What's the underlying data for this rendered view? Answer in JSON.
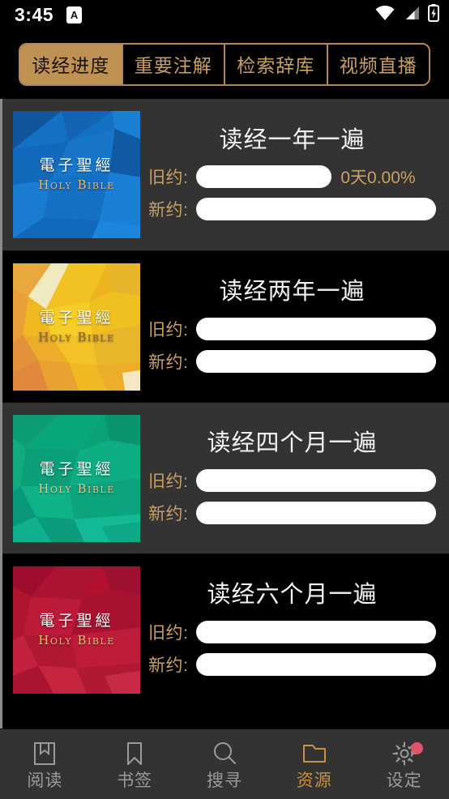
{
  "statusbar": {
    "time": "3:45",
    "app_icon_letter": "A",
    "icons": [
      "wifi-icon",
      "cellular-signal-icon",
      "battery-charging-icon"
    ]
  },
  "tabs": [
    {
      "label": "读经进度",
      "active": true,
      "name": "tab-reading-progress"
    },
    {
      "label": "重要注解",
      "active": false,
      "name": "tab-important-notes"
    },
    {
      "label": "检索辞库",
      "active": false,
      "name": "tab-search-lexicon"
    },
    {
      "label": "视频直播",
      "active": false,
      "name": "tab-video-live"
    }
  ],
  "colors": {
    "accent_gold": "#c9a063",
    "tab_active_bg": "#bf9153",
    "tab_border": "#b5894e",
    "nav_active": "#c9903f",
    "badge": "#e0536b",
    "card_shade_a": "#333333",
    "card_shade_b": "#000000"
  },
  "thumbnail": {
    "title_cn": "電子聖經",
    "title_en": "Holy Bible"
  },
  "plans": [
    {
      "title": "读经一年一遍",
      "thumb_theme": "blue",
      "shade": "shade-a",
      "old_testament": {
        "label": "旧约:",
        "progress": 0,
        "value": "0天0.00%",
        "short": true
      },
      "new_testament": {
        "label": "新约:",
        "progress": 0,
        "value": "",
        "short": false
      }
    },
    {
      "title": "读经两年一遍",
      "thumb_theme": "gold",
      "shade": "shade-b",
      "old_testament": {
        "label": "旧约:",
        "progress": 0,
        "value": "",
        "short": false
      },
      "new_testament": {
        "label": "新约:",
        "progress": 0,
        "value": "",
        "short": false
      }
    },
    {
      "title": "读经四个月一遍",
      "thumb_theme": "green",
      "shade": "shade-a",
      "old_testament": {
        "label": "旧约:",
        "progress": 0,
        "value": "",
        "short": false
      },
      "new_testament": {
        "label": "新约:",
        "progress": 0,
        "value": "",
        "short": false
      }
    },
    {
      "title": "读经六个月一遍",
      "thumb_theme": "red",
      "shade": "shade-b",
      "old_testament": {
        "label": "旧约:",
        "progress": 0,
        "value": "",
        "short": false
      },
      "new_testament": {
        "label": "新约:",
        "progress": 0,
        "value": "",
        "short": false
      }
    }
  ],
  "bottom_nav": [
    {
      "label": "阅读",
      "icon": "book-icon",
      "active": false,
      "badge": false,
      "name": "nav-read"
    },
    {
      "label": "书签",
      "icon": "bookmark-icon",
      "active": false,
      "badge": false,
      "name": "nav-bookmarks"
    },
    {
      "label": "搜寻",
      "icon": "search-icon",
      "active": false,
      "badge": false,
      "name": "nav-search"
    },
    {
      "label": "资源",
      "icon": "folder-icon",
      "active": true,
      "badge": false,
      "name": "nav-resources"
    },
    {
      "label": "设定",
      "icon": "gear-icon",
      "active": false,
      "badge": true,
      "name": "nav-settings"
    }
  ]
}
